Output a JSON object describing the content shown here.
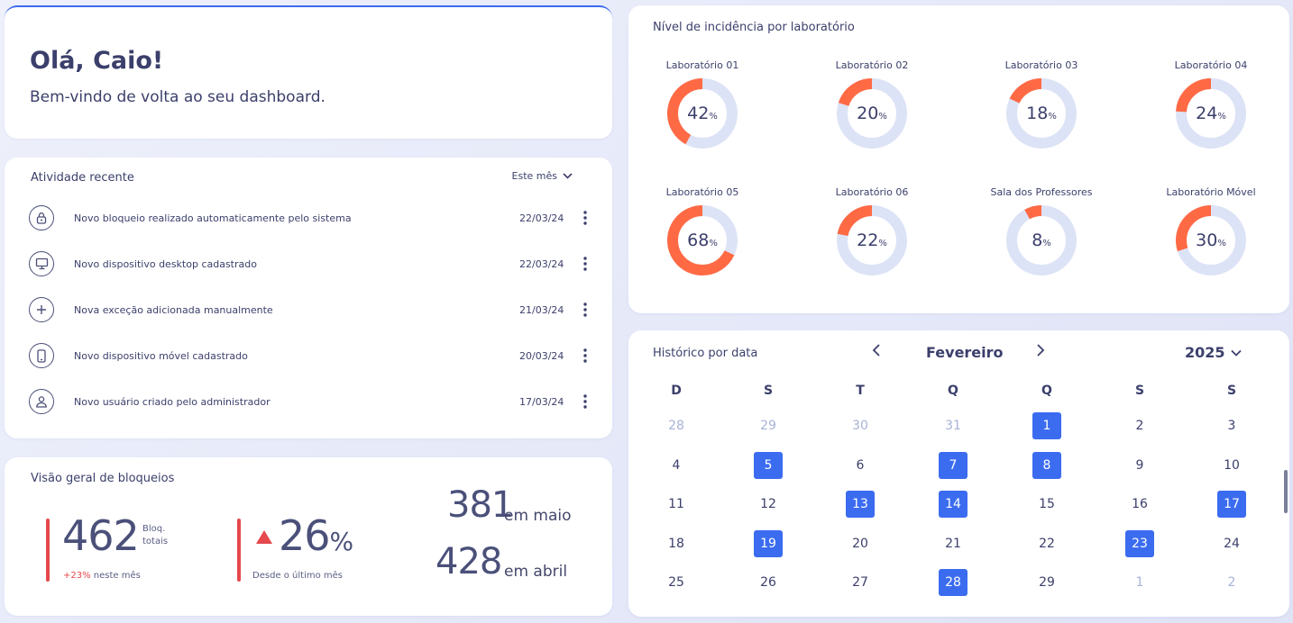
{
  "welcome": {
    "greeting": "Olá, Caio!",
    "subtitle": "Bem-vindo de volta ao seu dashboard."
  },
  "activity": {
    "title": "Atividade recente",
    "filter": "Este mês",
    "items": [
      {
        "icon": "lock-icon",
        "text": "Novo bloqueio realizado automaticamente pelo sistema",
        "date": "22/03/24"
      },
      {
        "icon": "desktop-icon",
        "text": "Novo dispositivo desktop cadastrado",
        "date": "22/03/24"
      },
      {
        "icon": "plus-icon",
        "text": "Nova exceção adicionada manualmente",
        "date": "21/03/24"
      },
      {
        "icon": "mobile-icon",
        "text": "Novo dispositivo móvel cadastrado",
        "date": "20/03/24"
      },
      {
        "icon": "user-icon",
        "text": "Novo usuário criado pelo administrador",
        "date": "17/03/24"
      }
    ]
  },
  "blocks": {
    "title": "Visão geral de bloqueios",
    "total_value": "462",
    "total_label_1": "Bloq.",
    "total_label_2": "totais",
    "total_change": "+23%",
    "total_change_suffix": "neste mês",
    "growth_value": "26",
    "growth_unit": "%",
    "growth_label": "Desde o último mês",
    "may_value": "381",
    "may_label": "em maio",
    "april_value": "428",
    "april_label": "em abril"
  },
  "labs": {
    "title": "Nível de incidência por laboratório",
    "accent": "#ff6a45",
    "track": "#dde3f6",
    "items": [
      {
        "name": "Laboratório 01",
        "value": 42
      },
      {
        "name": "Laboratório 02",
        "value": 20
      },
      {
        "name": "Laboratório 03",
        "value": 18
      },
      {
        "name": "Laboratório 04",
        "value": 24
      },
      {
        "name": "Laboratório 05",
        "value": 68
      },
      {
        "name": "Laboratório 06",
        "value": 22
      },
      {
        "name": "Sala dos Professores",
        "value": 8
      },
      {
        "name": "Laboratório Móvel",
        "value": 30
      }
    ]
  },
  "calendar": {
    "title": "Histórico por data",
    "month": "Fevereiro",
    "year": "2025",
    "weekdays": [
      "D",
      "S",
      "T",
      "Q",
      "Q",
      "S",
      "S"
    ],
    "weeks": [
      [
        {
          "d": "28",
          "m": true
        },
        {
          "d": "29",
          "m": true
        },
        {
          "d": "30",
          "m": true
        },
        {
          "d": "31",
          "m": true
        },
        {
          "d": "1",
          "h": true
        },
        {
          "d": "2"
        },
        {
          "d": "3"
        }
      ],
      [
        {
          "d": "4"
        },
        {
          "d": "5",
          "h": true
        },
        {
          "d": "6"
        },
        {
          "d": "7",
          "h": true
        },
        {
          "d": "8",
          "h": true
        },
        {
          "d": "9"
        },
        {
          "d": "10"
        }
      ],
      [
        {
          "d": "11"
        },
        {
          "d": "12"
        },
        {
          "d": "13",
          "h": true
        },
        {
          "d": "14",
          "h": true
        },
        {
          "d": "15"
        },
        {
          "d": "16"
        },
        {
          "d": "17",
          "h": true
        }
      ],
      [
        {
          "d": "18"
        },
        {
          "d": "19",
          "h": true
        },
        {
          "d": "20"
        },
        {
          "d": "21"
        },
        {
          "d": "22"
        },
        {
          "d": "23",
          "h": true
        },
        {
          "d": "24"
        }
      ],
      [
        {
          "d": "25"
        },
        {
          "d": "26"
        },
        {
          "d": "27"
        },
        {
          "d": "28",
          "h": true
        },
        {
          "d": "29"
        },
        {
          "d": "1",
          "m": true
        },
        {
          "d": "2",
          "m": true
        }
      ]
    ]
  }
}
